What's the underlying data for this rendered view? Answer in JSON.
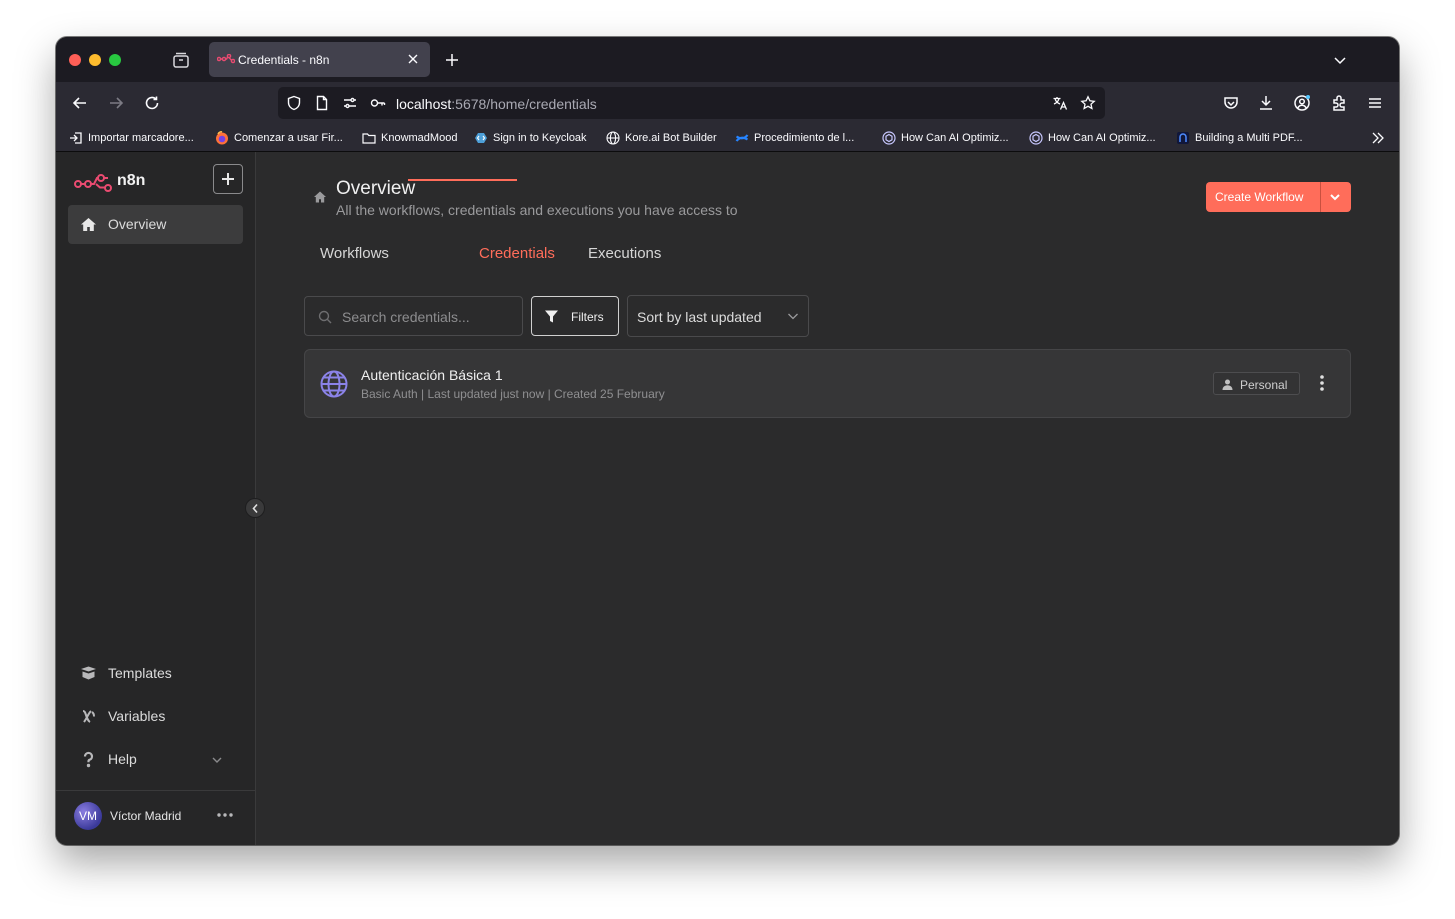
{
  "browser": {
    "tab_title": "Credentials - n8n",
    "url_host": "localhost",
    "url_path": ":5678/home/credentials",
    "bookmarks": [
      {
        "label": "Importar marcadore..."
      },
      {
        "label": "Comenzar a usar Fir..."
      },
      {
        "label": "KnowmadMood"
      },
      {
        "label": "Sign in to Keycloak"
      },
      {
        "label": "Kore.ai Bot Builder"
      },
      {
        "label": "Procedimiento de l..."
      },
      {
        "label": "How Can AI Optimiz..."
      },
      {
        "label": "How Can AI Optimiz..."
      },
      {
        "label": "Building a Multi PDF..."
      }
    ]
  },
  "app": {
    "logo_text": "n8n",
    "sidebar": {
      "top_items": [
        {
          "label": "Overview",
          "icon": "home-icon",
          "active": true
        }
      ],
      "bottom_items": [
        {
          "label": "Templates",
          "icon": "box-open-icon"
        },
        {
          "label": "Variables",
          "icon": "variable-icon"
        },
        {
          "label": "Help",
          "icon": "question-icon"
        }
      ],
      "user": {
        "initials": "VM",
        "name": "Víctor Madrid"
      }
    },
    "header": {
      "title": "Overview",
      "subtitle": "All the workflows, credentials and executions you have access to",
      "create_button": "Create Workflow"
    },
    "tabs": [
      {
        "label": "Workflows",
        "active": false
      },
      {
        "label": "Credentials",
        "active": true
      },
      {
        "label": "Executions",
        "active": false
      }
    ],
    "toolbar": {
      "search_placeholder": "Search credentials...",
      "filters_label": "Filters",
      "sort_value": "Sort by last updated"
    },
    "credentials": [
      {
        "name": "Autenticación Básica 1",
        "meta": "Basic Auth | Last updated just now | Created 25 February",
        "badge": "Personal",
        "icon": "globe-icon"
      }
    ],
    "colors": {
      "accent": "#ff6d5a",
      "sidebar_bg": "#262627",
      "main_bg": "#2b2b2c"
    }
  }
}
